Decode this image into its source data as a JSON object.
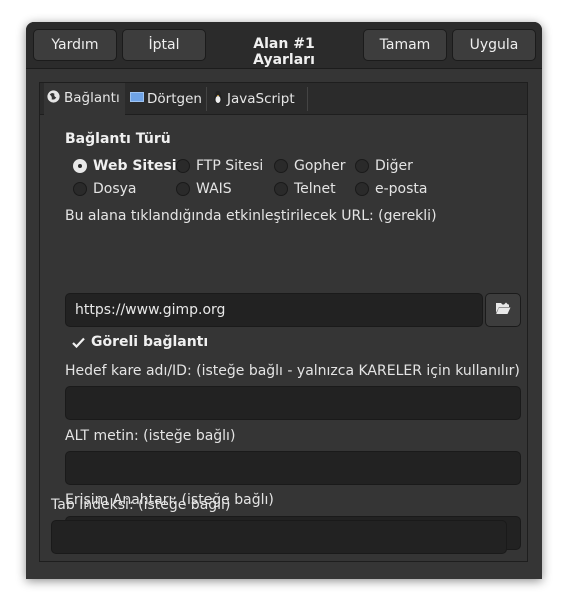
{
  "header": {
    "help_label": "Yardım",
    "cancel_label": "İptal",
    "title": "Alan #1 Ayarları",
    "ok_label": "Tamam",
    "apply_label": "Uygula"
  },
  "tabs": [
    {
      "label": "Bağlantı",
      "icon": "globe-icon",
      "active": true
    },
    {
      "label": "Dörtgen",
      "icon": "rectangle-icon",
      "active": false
    },
    {
      "label": "JavaScript",
      "icon": "javascript-icon",
      "active": false
    }
  ],
  "link_type": {
    "heading": "Bağlantı Türü",
    "options": [
      "Web Sitesi",
      "FTP Sitesi",
      "Gopher",
      "Diğer",
      "Dosya",
      "WAIS",
      "Telnet",
      "e-posta"
    ],
    "selected": "Web Sitesi"
  },
  "url": {
    "label": "Bu alana tıklandığında etkinleştirilecek URL: (gerekli)",
    "value": "https://www.gimp.org"
  },
  "relative_link": {
    "label": "Göreli bağlantı",
    "checked": true
  },
  "fields": {
    "target_label": "Hedef kare adı/ID: (isteğe bağlı - yalnızca KARELER için kullanılır)",
    "target_value": "",
    "alt_label": "ALT metin: (isteğe bağlı)",
    "alt_value": "",
    "access_key_label": "Erişim Anahtarı: (isteğe bağlı)",
    "access_key_value": "",
    "tab_index_label": "Tab İndeksi: (isteğe bağlı)",
    "tab_index_value": ""
  },
  "colors": {
    "window_bg": "#353535",
    "header_bg": "#2b2b2b",
    "entry_bg": "#222222"
  }
}
